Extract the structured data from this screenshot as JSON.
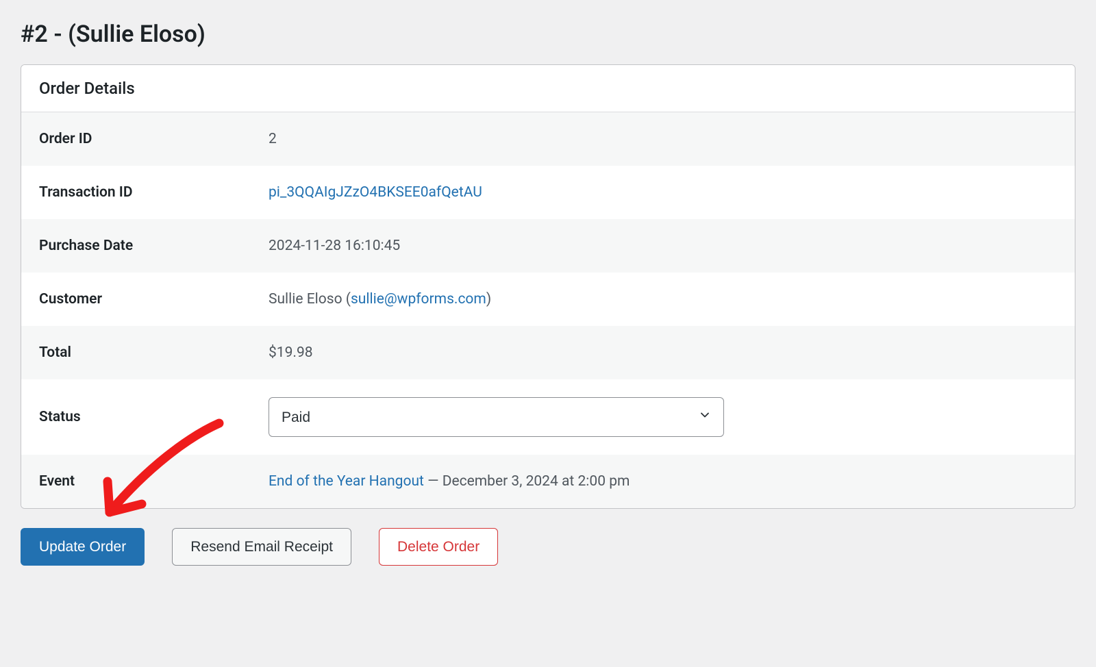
{
  "page_title": "#2 - (Sullie Eloso)",
  "panel_header": "Order Details",
  "rows": {
    "order_id": {
      "label": "Order ID",
      "value": "2"
    },
    "transaction_id": {
      "label": "Transaction ID",
      "link": "pi_3QQAIgJZzO4BKSEE0afQetAU"
    },
    "purchase_date": {
      "label": "Purchase Date",
      "value": "2024-11-28 16:10:45"
    },
    "customer": {
      "label": "Customer",
      "name": "Sullie Eloso",
      "email": "sullie@wpforms.com"
    },
    "total": {
      "label": "Total",
      "value": "$19.98"
    },
    "status": {
      "label": "Status",
      "selected": "Paid"
    },
    "event": {
      "label": "Event",
      "link": "End of the Year Hangout",
      "suffix": " — December 3, 2024 at 2:00 pm"
    }
  },
  "buttons": {
    "update": "Update Order",
    "resend": "Resend Email Receipt",
    "delete": "Delete Order"
  }
}
